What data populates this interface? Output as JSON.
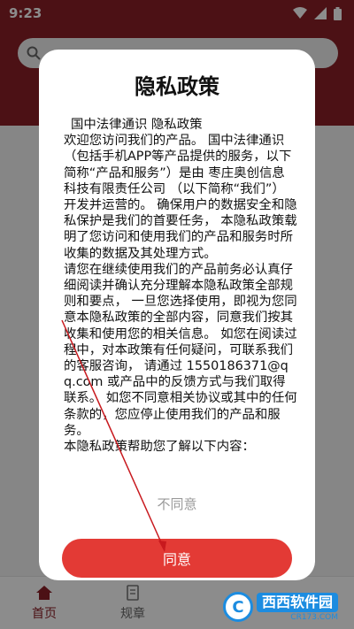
{
  "status_bar": {
    "time": "9:23"
  },
  "search": {
    "placeholder": ""
  },
  "bottom_nav": [
    {
      "label": "首页"
    },
    {
      "label": "规章"
    }
  ],
  "dialog": {
    "title": "隐私政策",
    "paragraphs": [
      "国中法律通识 隐私政策",
      "欢迎您访问我们的产品。 国中法律通识 （包括手机APP等产品提供的服务，以下简称“产品和服务”）是由 枣庄奥创信息科技有限责任公司 （以下简称“我们”）开发并运营的。 确保用户的数据安全和隐私保护是我们的首要任务， 本隐私政策载明了您访问和使用我们的产品和服务时所收集的数据及其处理方式。",
      "请您在继续使用我们的产品前务必认真仔细阅读并确认充分理解本隐私政策全部规则和要点， 一旦您选择使用，即视为您同意本隐私政策的全部内容，同意我们按其收集和使用您的相关信息。 如您在阅读过程中，对本政策有任何疑问，可联系我们的客服咨询， 请通过 1550186371@qq.com 或产品中的反馈方式与我们取得联系。 如您不同意相关协议或其中的任何条款的，您应停止使用我们的产品和服务。",
      "本隐私政策帮助您了解以下内容："
    ],
    "disagree_label": "不同意",
    "agree_label": "同意"
  },
  "watermark": {
    "main": "西西软件园",
    "sub": "CR173.COM",
    "logo": "C"
  },
  "colors": {
    "brand": "#8b2027",
    "accent": "#e33a35",
    "annotation": "#c8191e"
  }
}
